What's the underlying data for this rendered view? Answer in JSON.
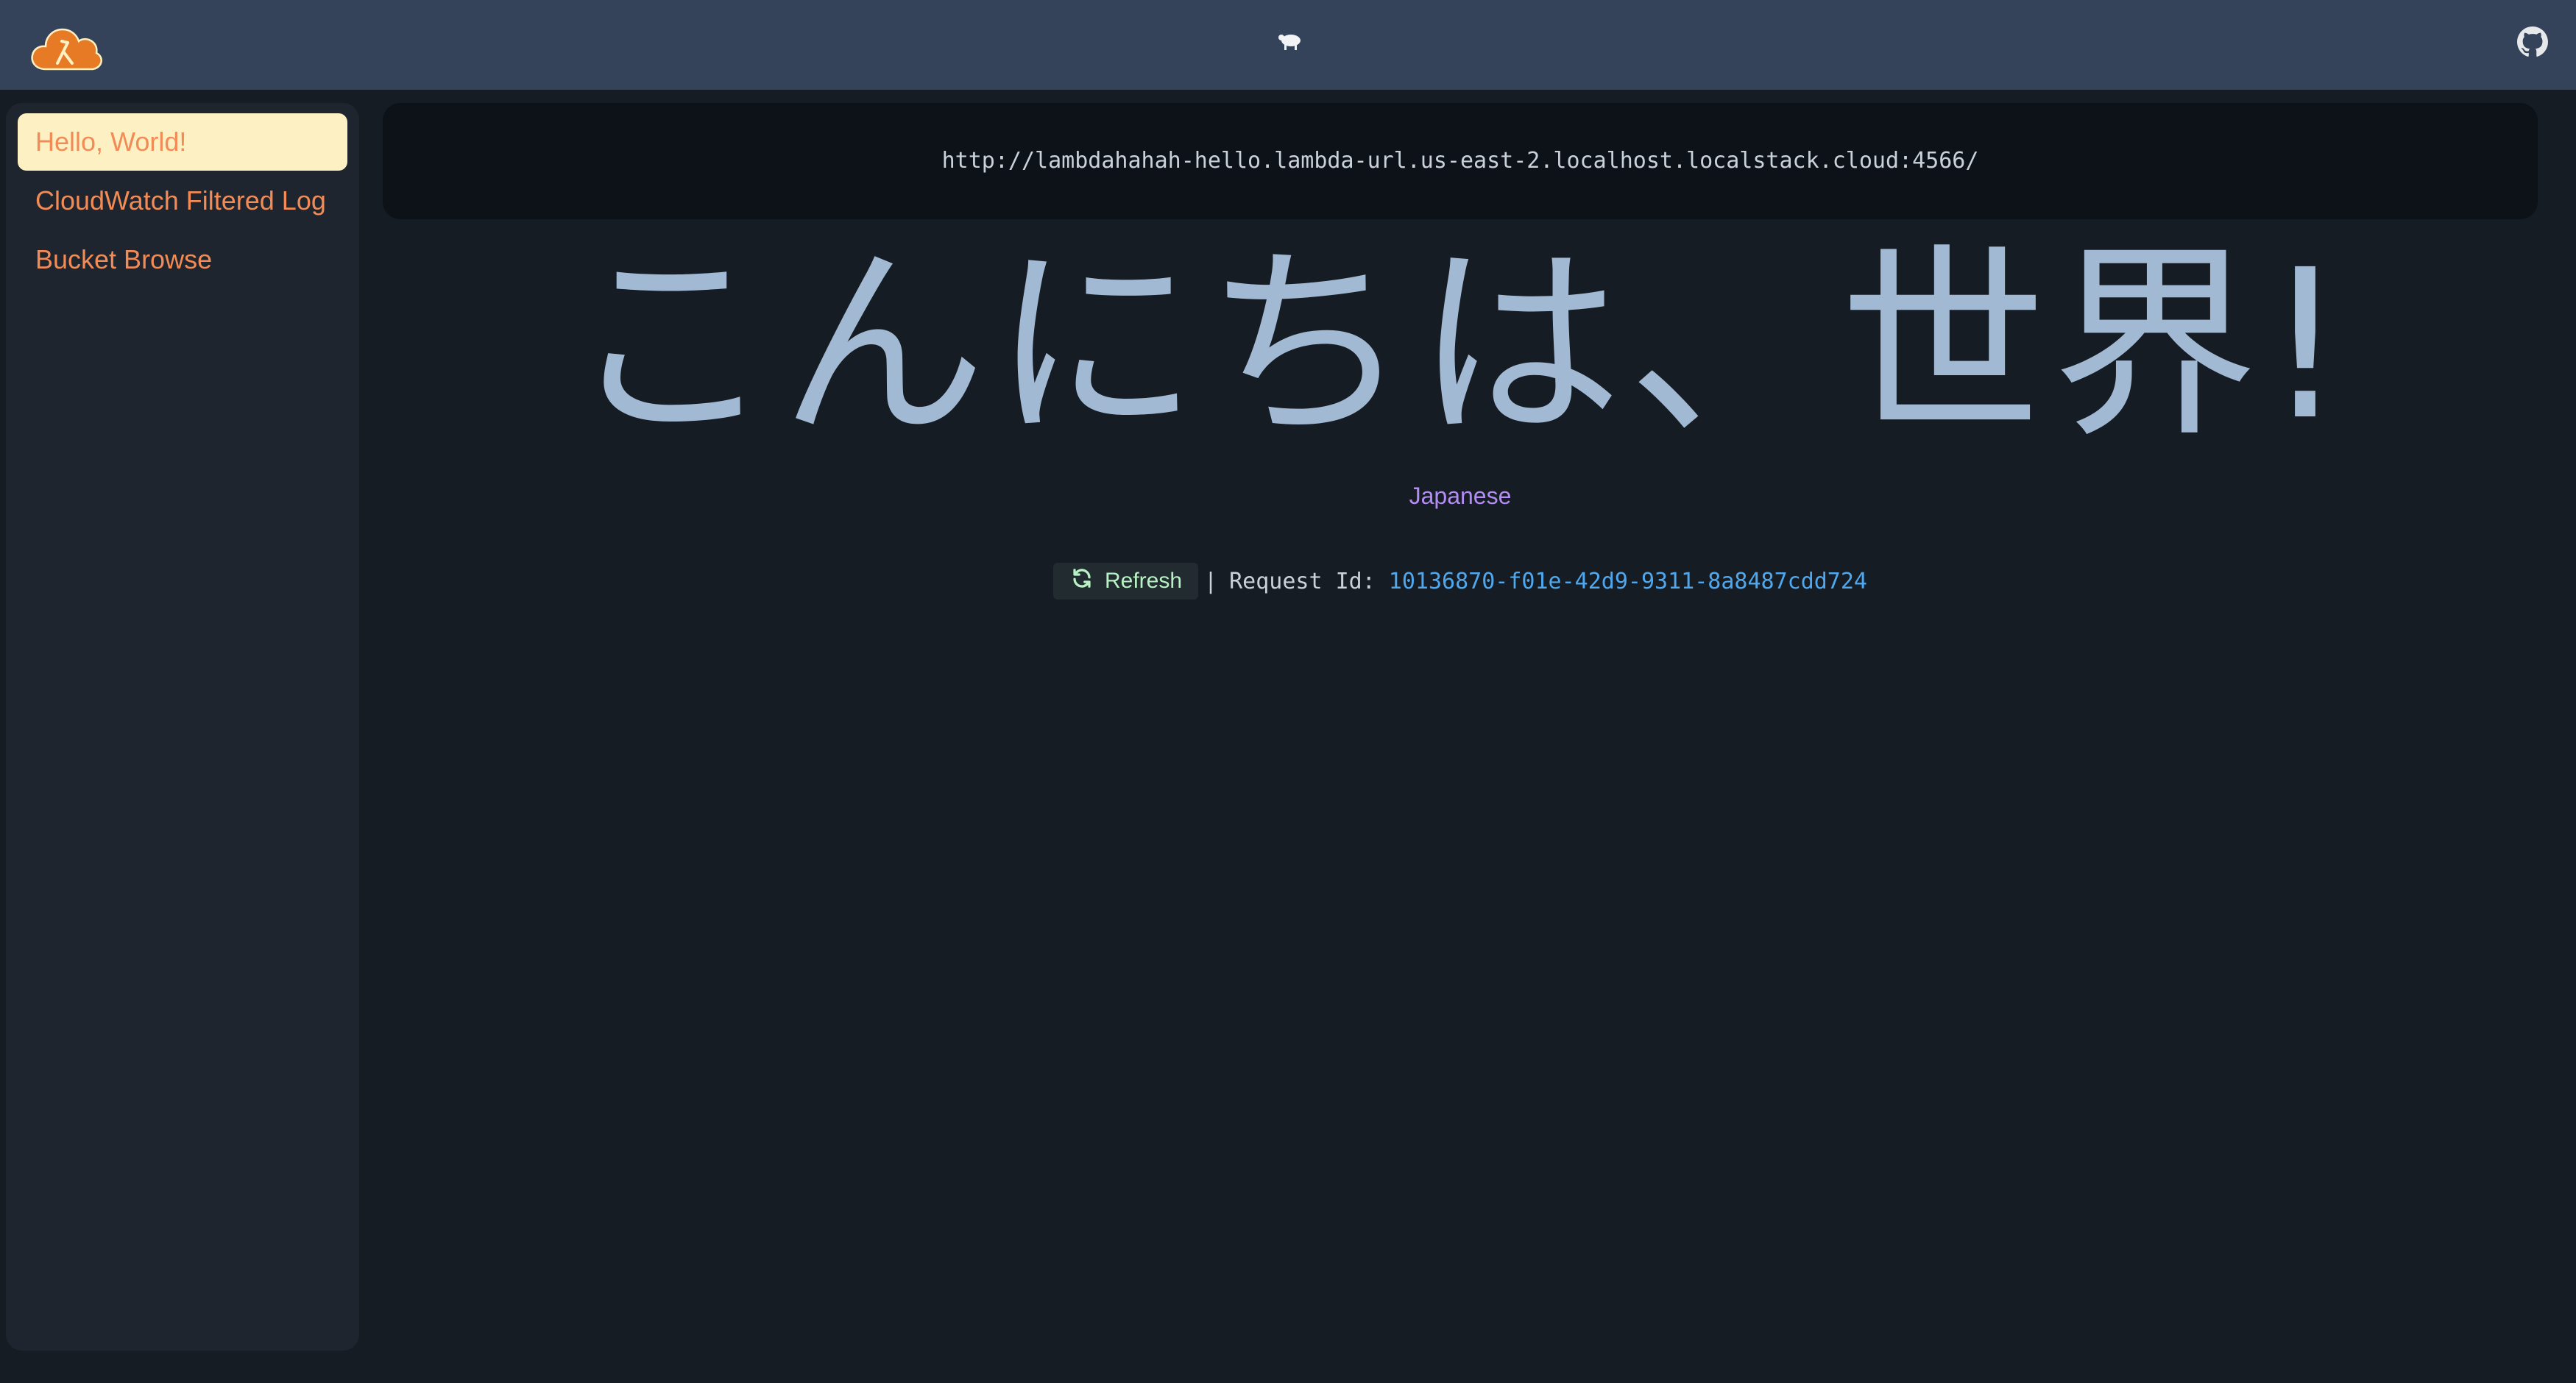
{
  "header": {
    "logo_icon": "lambda-cloud-logo-icon",
    "center_icon": "sheep-icon",
    "right_icon": "github-icon"
  },
  "sidebar": {
    "items": [
      {
        "label": "Hello, World!",
        "active": true
      },
      {
        "label": "CloudWatch Filtered Log",
        "active": false
      },
      {
        "label": "Bucket Browse",
        "active": false
      }
    ]
  },
  "main": {
    "url": "http://lambdahahah-hello.lambda-url.us-east-2.localhost.localstack.cloud:4566/",
    "greeting": "こんにちは、世界!",
    "language": "Japanese",
    "refresh_label": "Refresh",
    "separator": "|",
    "request_id_label": "Request Id:",
    "request_id": "10136870-f01e-42d9-9311-8a8487cdd724"
  },
  "colors": {
    "topbar": "#34425a",
    "background": "#161c24",
    "sidebar": "#1e252e",
    "nav_text": "#f28b55",
    "nav_active_bg": "#fdf0c3",
    "greeting": "#a2b9d3",
    "language": "#b48cf5",
    "request_id": "#4fa8ee",
    "refresh_text": "#b8f2c4"
  }
}
